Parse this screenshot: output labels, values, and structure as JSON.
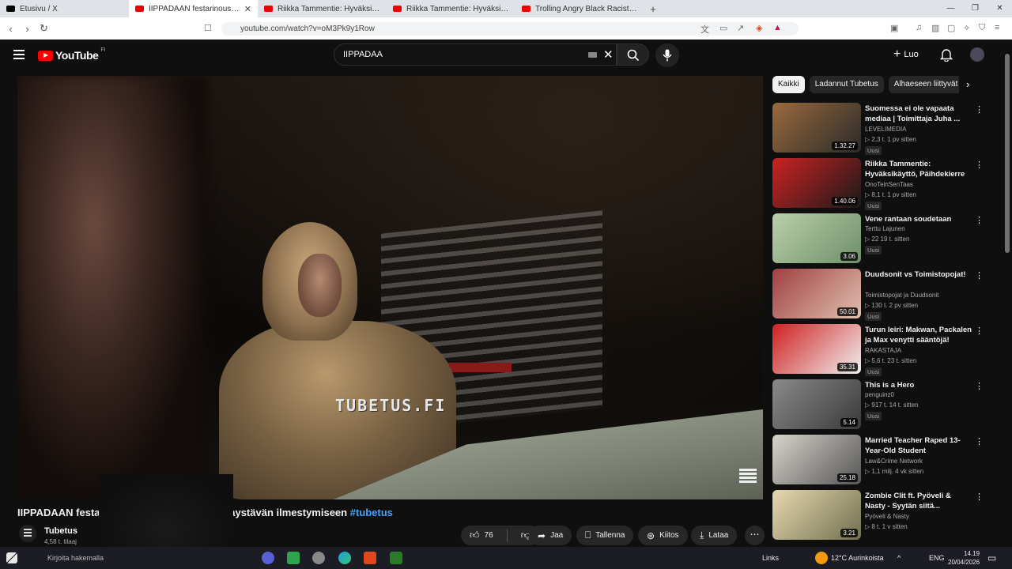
{
  "browser": {
    "tabs": [
      {
        "label": "Etusivu / X",
        "favicon": "x-icon",
        "active": false
      },
      {
        "label": "IIPPADAAN festarinoussu päätti...",
        "favicon": "youtube-icon",
        "active": true
      },
      {
        "label": "Riikka Tammentie: Hyväksikäyttö, Pä...",
        "favicon": "youtube-icon",
        "active": false
      },
      {
        "label": "Riikka Tammentie: Hyväksikäyttö, Pä...",
        "favicon": "youtube-icon",
        "active": false
      },
      {
        "label": "Trolling Angry Black Racists! - YouTu...",
        "favicon": "youtube-icon",
        "active": false
      }
    ],
    "new_tab": "+",
    "window_controls": [
      "—",
      "❐",
      "✕"
    ],
    "url": "youtube.com/watch?v=oM3Pk9y1Row"
  },
  "header": {
    "logo": "YouTube",
    "country": "FI",
    "search_value": "IIPPADAA",
    "create_label": "Luo"
  },
  "video": {
    "watermark": "TUBETUS.FI",
    "title_start": "IIPPADAAN festa",
    "title_end": "polkaystävän ilmestymiseen",
    "hashtag": "#tubetus",
    "channel": "Tubetus",
    "subs": "4,58 t. tilaaj",
    "likes": "76",
    "share": "Jaa",
    "save": "Tallenna",
    "thanks": "Kiitos",
    "download": "Lataa"
  },
  "chips": [
    "Kaikki",
    "Ladannut Tubetus",
    "Alhaeseen liittyvät"
  ],
  "recommendations": [
    {
      "title": "Suomessa ei ole vapaata mediaa | Toimittaja Juha ...",
      "channel": "LEVELIMEDIA",
      "stats": "▷ 2,3 t.   1 pv sitten",
      "badge": "Uusi",
      "duration": "1.32.27",
      "colors": [
        "#9a6a3c",
        "#2a2a2a"
      ]
    },
    {
      "title": "Riikka Tammentie: Hyväksikäyttö, Päihdekierre j...",
      "channel": "OnoTeinSenTaas",
      "stats": "▷ 8,1 t.   1 pv sitten",
      "badge": "Uusi",
      "duration": "1.40.06",
      "colors": [
        "#cc2222",
        "#1a1a1a"
      ]
    },
    {
      "title": "Vene rantaan soudetaan",
      "channel": "Terttu Lajunen",
      "stats": "▷ 22   19 t. sitten",
      "badge": "Uusi",
      "duration": "3.06",
      "colors": [
        "#b9d0a8",
        "#6e8f6a"
      ]
    },
    {
      "title": "Duudsonit vs Toimistopojat!",
      "channel": "Toimistopojat ja Duudsonit",
      "stats": "▷ 130 t.   2 pv sitten",
      "badge": "Uusi",
      "duration": "50.01",
      "colors": [
        "#a04040",
        "#e0c0b0"
      ]
    },
    {
      "title": "Turun leiri: Makwan, Packalen ja Max venytti sääntöjä!",
      "channel": "RAKASTAJA",
      "stats": "▷ 5,6 t.   23 t. sitten",
      "badge": "Uusi",
      "duration": "35.31",
      "colors": [
        "#d02020",
        "#f0f0f0"
      ]
    },
    {
      "title": "This is a Hero",
      "channel": "penguinz0",
      "stats": "▷ 917 t.   14 t. sitten",
      "badge": "Uusi",
      "duration": "5.14",
      "colors": [
        "#8a8a8a",
        "#3a3a3a"
      ]
    },
    {
      "title": "Married Teacher Raped 13-Year-Old Student",
      "channel": "Law&Crime Network",
      "stats": "▷ 1,1 milj.   4 vk sitten",
      "badge": "",
      "duration": "25.18",
      "colors": [
        "#d8d4cc",
        "#555"
      ]
    },
    {
      "title": "Zombie Clit ft. Pyöveli & Nasty - Syytän siitä...",
      "channel": "Pyöveli & Nasty",
      "stats": "▷ 8 t.   1 v sitten",
      "badge": "",
      "duration": "3.21",
      "colors": [
        "#e8d8b0",
        "#707050"
      ]
    }
  ],
  "taskbar": {
    "search_text": "Kirjoita hakemalla",
    "links": "Links",
    "weather": "12°C  Aurinkoista",
    "lang": "ENG",
    "time": "14.19",
    "date": "20/04/2026"
  }
}
